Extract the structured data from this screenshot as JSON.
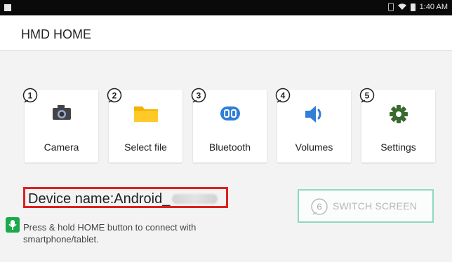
{
  "status_bar": {
    "time": "1:40 AM"
  },
  "app": {
    "title": "HMD HOME"
  },
  "tiles": [
    {
      "num": "1",
      "label": "Camera",
      "icon": "camera-icon"
    },
    {
      "num": "2",
      "label": "Select file",
      "icon": "folder-icon"
    },
    {
      "num": "3",
      "label": "Bluetooth",
      "icon": "bluetooth-icon"
    },
    {
      "num": "4",
      "label": "Volumes",
      "icon": "speaker-icon"
    },
    {
      "num": "5",
      "label": "Settings",
      "icon": "gear-icon"
    }
  ],
  "device": {
    "label": "Device name:Android_"
  },
  "switch_screen": {
    "num": "6",
    "label": "SWITCH SCREEN"
  },
  "hint": {
    "text": "Press & hold HOME button to connect with smartphone/tablet."
  },
  "colors": {
    "highlight": "#e01f1f",
    "switch_border": "#8fd8c2",
    "mic": "#1aaa4b"
  }
}
